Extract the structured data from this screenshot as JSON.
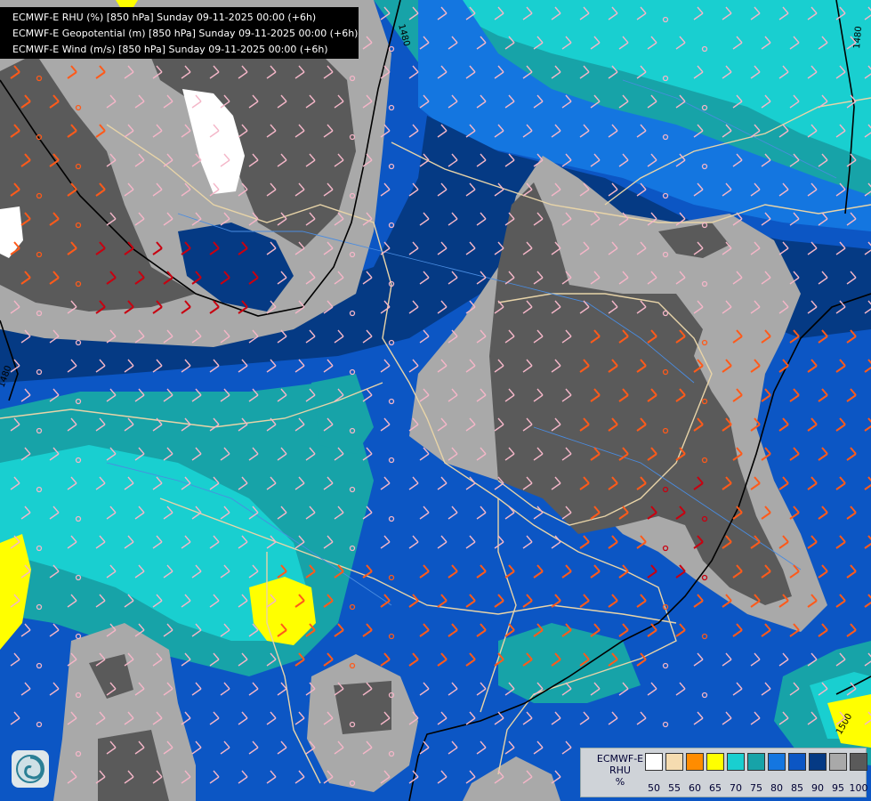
{
  "title_lines": [
    "ECMWF-E RHU (%) [850 hPa] Sunday 09-11-2025 00:00 (+6h)",
    "ECMWF-E Geopotential (m) [850 hPa] Sunday 09-11-2025 00:00 (+6h)",
    "ECMWF-E Wind (m/s) [850 hPa] Sunday 09-11-2025 00:00 (+6h)"
  ],
  "legend": {
    "title": [
      "ECMWF-E",
      "RHU",
      "%"
    ],
    "bins": [
      {
        "label": "50",
        "color": "#ffffff"
      },
      {
        "label": "55",
        "color": "#f5dcb0"
      },
      {
        "label": "60",
        "color": "#ff8c00"
      },
      {
        "label": "65",
        "color": "#ffff00"
      },
      {
        "label": "70",
        "color": "#19cfd0"
      },
      {
        "label": "75",
        "color": "#17a3a8"
      },
      {
        "label": "80",
        "color": "#1476e0"
      },
      {
        "label": "85",
        "color": "#0c56c4"
      },
      {
        "label": "90",
        "color": "#053a84"
      },
      {
        "label": "95",
        "color": "#a9a9a9"
      },
      {
        "label": "100",
        "color": "#5a5a5a"
      }
    ]
  },
  "contour_labels": [
    "1480",
    "1480",
    "1480",
    "1500"
  ],
  "colors": {
    "geopotential_line": "#000000",
    "border": "#e8d4a8",
    "river": "#4a8ce0"
  },
  "icons": {
    "logo": "ecmwf-swirl-logo"
  }
}
